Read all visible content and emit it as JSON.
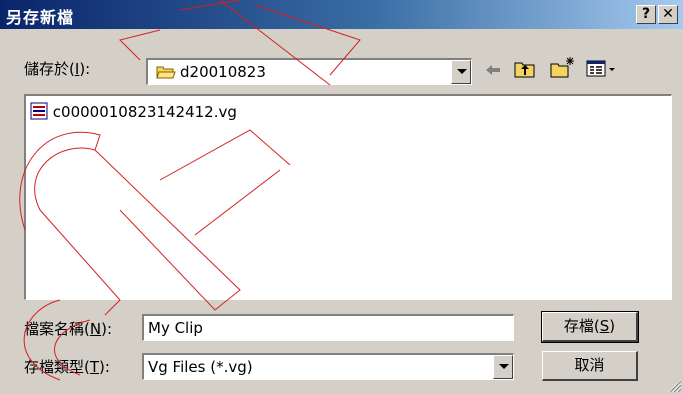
{
  "window": {
    "title": "另存新檔",
    "help_button": "?",
    "close_button": "✕"
  },
  "save_in": {
    "label": "儲存於",
    "hotkey": "I",
    "value": "d20010823"
  },
  "toolbar": {
    "back_icon": "arrow-left-icon",
    "up_icon": "folder-up-icon",
    "new_folder_icon": "new-folder-icon",
    "view_icon": "view-menu-icon"
  },
  "files": [
    {
      "name": "c0000010823142412.vg"
    }
  ],
  "filename": {
    "label": "檔案名稱",
    "hotkey": "N",
    "value": "My Clip"
  },
  "filetype": {
    "label": "存檔類型",
    "hotkey": "T",
    "value": "Vg Files (*.vg)"
  },
  "buttons": {
    "save": "存檔",
    "save_hotkey": "S",
    "cancel": "取消"
  },
  "colors": {
    "title_start": "#0a246a",
    "title_end": "#a6caf0",
    "face": "#d4d0c8",
    "watermark": "#d42020"
  }
}
